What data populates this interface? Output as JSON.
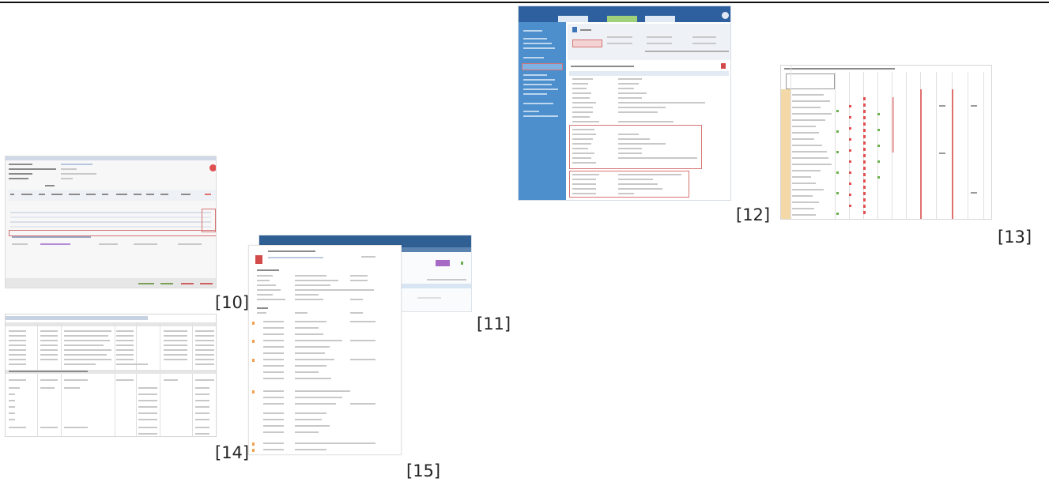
{
  "captions": {
    "c10": "[10]",
    "c11": "[11]",
    "c12": "[12]",
    "c13": "[13]",
    "c14": "[14]",
    "c15": "[15]"
  },
  "colors": {
    "header_blue": "#2e5f9e",
    "sidebar_blue": "#4d8fcc",
    "accent_red": "#e06060",
    "accent_green": "#6ab04c",
    "purple_button": "#9b59b6"
  }
}
